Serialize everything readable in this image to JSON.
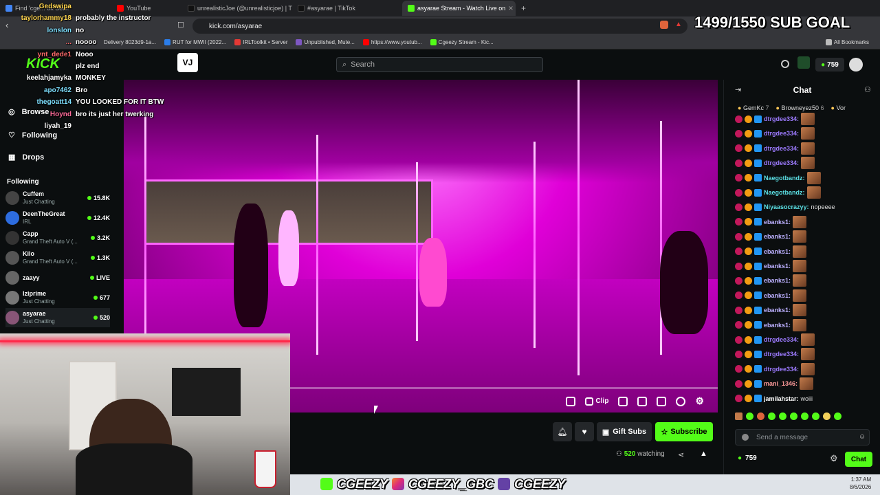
{
  "browser": {
    "tabs": [
      {
        "label": "Find 'cge... ok Sear...",
        "color": "#4285f4"
      },
      {
        "label": "YouTube",
        "color": "#ff0000"
      },
      {
        "label": "unrealisticJoe (@unrealisticjoe) | TikT...",
        "color": "#111111"
      },
      {
        "label": "#asyarae | TikTok",
        "color": "#111111"
      },
      {
        "label": "asyarae Stream - Watch Live on",
        "color": "#53fc18"
      }
    ],
    "url": "kick.com/asyarae",
    "bookmarks": [
      {
        "label": "Delivery 8023d9-1a...",
        "color": "#888888"
      },
      {
        "label": "RUT for MWII (2022...",
        "color": "#2b7de9"
      },
      {
        "label": "IRLToolkit • Server",
        "color": "#e53935"
      },
      {
        "label": "Unpublished, Mute...",
        "color": "#7e57c2"
      },
      {
        "label": "https://www.youtub...",
        "color": "#ff0000"
      },
      {
        "label": "Cgeezy Stream - Kic...",
        "color": "#53fc18"
      }
    ],
    "all_bookmarks": "All Bookmarks"
  },
  "sub_goal": "1499/1550 SUB GOAL",
  "overlay_chat": [
    {
      "user": "Gedswipa",
      "text": "",
      "color": "#ffd54f"
    },
    {
      "user": "taylorhammy18",
      "text": "probably the instructor",
      "color": "#ffd54f"
    },
    {
      "user": "lonslon",
      "text": "no",
      "color": "#7ee0ff"
    },
    {
      "user": "...",
      "text": "noooo",
      "color": "#ff6b6b"
    },
    {
      "user": "ynt_dede1",
      "text": "Nooo",
      "color": "#ff6b6b"
    },
    {
      "user": "",
      "text": "plz end",
      "color": "#ffffff"
    },
    {
      "user": "keelahjamyka",
      "text": "MONKEY",
      "color": "#ffffff"
    },
    {
      "user": "apo7462",
      "text": "Bro",
      "color": "#7ee0ff"
    },
    {
      "user": "thegoatt14",
      "text": "YOU LOOKED FOR IT BTW",
      "color": "#7ee0ff"
    },
    {
      "user": "Hoynd",
      "text": "bro its just her twerking",
      "color": "#ff6b9a"
    },
    {
      "user": "liyah_19",
      "text": "",
      "color": "#ffffff"
    }
  ],
  "nav": {
    "search_placeholder": "Search",
    "balance": "759",
    "browse": "Browse",
    "following": "Following",
    "drops": "Drops",
    "following_header": "Following"
  },
  "following": [
    {
      "name": "Cuffem",
      "game": "Just Chatting",
      "viewers": "15.8K",
      "color": "#444"
    },
    {
      "name": "DeenTheGreat",
      "game": "IRL",
      "viewers": "12.4K",
      "color": "#2d6cdf"
    },
    {
      "name": "Capp",
      "game": "Grand Theft Auto V (...",
      "viewers": "3.2K",
      "color": "#333"
    },
    {
      "name": "Kilo",
      "game": "Grand Theft Auto V (...",
      "viewers": "1.3K",
      "color": "#555"
    },
    {
      "name": "zaayy",
      "game": "",
      "viewers": "LIVE",
      "color": "#666"
    },
    {
      "name": "Iziprime",
      "game": "Just Chatting",
      "viewers": "677",
      "color": "#777"
    },
    {
      "name": "asyarae",
      "game": "Just Chatting",
      "viewers": "520",
      "color": "#885577"
    }
  ],
  "player": {
    "progress": 0.07,
    "clip_label": "Clip",
    "gift_subs": "Gift Subs",
    "subscribe": "Subscribe",
    "watching_count": "520",
    "watching_label": "watching"
  },
  "chat": {
    "title": "Chat",
    "gifters": [
      {
        "name": "GemKc",
        "count": "7"
      },
      {
        "name": "Browneyez50",
        "count": "6"
      },
      {
        "name": "Vor",
        "count": ""
      }
    ],
    "messages": [
      {
        "user": "dtrgdee334:",
        "text": "",
        "color": "#9d7bff"
      },
      {
        "user": "dtrgdee334:",
        "text": "",
        "color": "#9d7bff"
      },
      {
        "user": "dtrgdee334:",
        "text": "",
        "color": "#9d7bff"
      },
      {
        "user": "dtrgdee334:",
        "text": "",
        "color": "#9d7bff"
      },
      {
        "user": "Naegotbandz:",
        "text": "",
        "color": "#5ce1e6"
      },
      {
        "user": "Naegotbandz:",
        "text": "",
        "color": "#5ce1e6"
      },
      {
        "user": "Niyaasocrazyy:",
        "text": "nopeeee",
        "color": "#5ce1e6"
      },
      {
        "user": "ebanks1:",
        "text": "",
        "color": "#bcb0ff"
      },
      {
        "user": "ebanks1:",
        "text": "",
        "color": "#bcb0ff"
      },
      {
        "user": "ebanks1:",
        "text": "",
        "color": "#bcb0ff"
      },
      {
        "user": "ebanks1:",
        "text": "",
        "color": "#bcb0ff"
      },
      {
        "user": "ebanks1:",
        "text": "",
        "color": "#bcb0ff"
      },
      {
        "user": "ebanks1:",
        "text": "",
        "color": "#bcb0ff"
      },
      {
        "user": "ebanks1:",
        "text": "",
        "color": "#bcb0ff"
      },
      {
        "user": "ebanks1:",
        "text": "",
        "color": "#bcb0ff"
      },
      {
        "user": "dtrgdee334:",
        "text": "",
        "color": "#9d7bff"
      },
      {
        "user": "dtrgdee334:",
        "text": "",
        "color": "#9d7bff"
      },
      {
        "user": "dtrgdee334:",
        "text": "",
        "color": "#9d7bff"
      },
      {
        "user": "mani_1346:",
        "text": "",
        "color": "#ff9b9b"
      },
      {
        "user": "jamilahstar:",
        "text": "woiii",
        "color": "#ffffff"
      }
    ],
    "input_placeholder": "Send a message",
    "balance": "759",
    "send_label": "Chat"
  },
  "banner": {
    "items": [
      "CGEEZY",
      "CGEEZY_GBC",
      "CGEEZY"
    ]
  },
  "clock": {
    "time": "1:37 AM",
    "date": "8/6/2026"
  },
  "colors": {
    "kick_green": "#53fc18",
    "magenta": "#e000d8"
  }
}
